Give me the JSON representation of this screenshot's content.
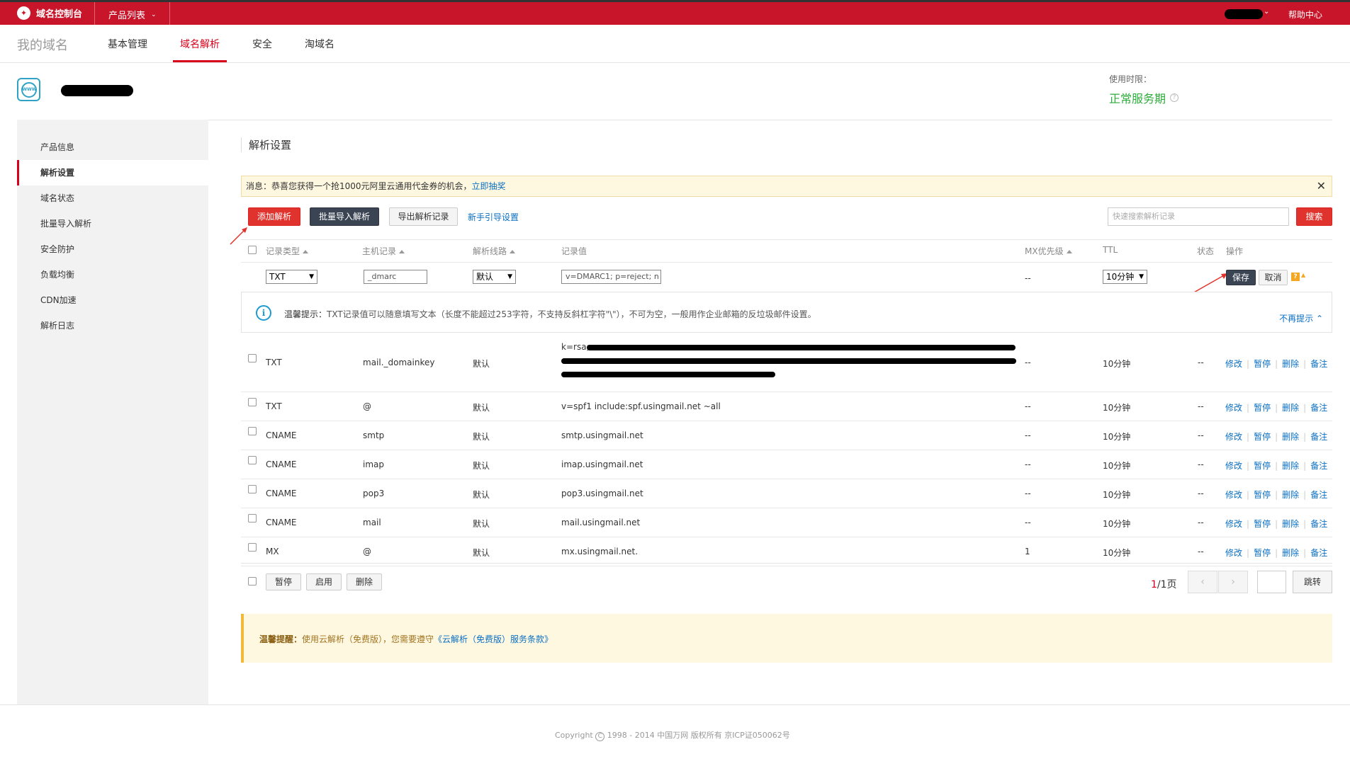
{
  "topbar": {
    "brand": "域名控制台",
    "product_list": "产品列表",
    "help": "帮助中心"
  },
  "nav": {
    "my_domains": "我的域名",
    "items": [
      "基本管理",
      "域名解析",
      "安全",
      "淘域名"
    ],
    "active": "域名解析"
  },
  "domain": {
    "icon_text": "WWW",
    "period_label": "使用时限：",
    "period_value": "正常服务期"
  },
  "sidebar": {
    "items": [
      "产品信息",
      "解析设置",
      "域名状态",
      "批量导入解析",
      "安全防护",
      "负载均衡",
      "CDN加速",
      "解析日志"
    ],
    "active": "解析设置"
  },
  "main": {
    "title": "解析设置",
    "notice_text": "消息：恭喜您获得一个抢1000元阿里云通用代金券的机会，",
    "notice_link": "立即抽奖",
    "buttons": {
      "add": "添加解析",
      "batch_import": "批量导入解析",
      "export": "导出解析记录",
      "guide": "新手引导设置",
      "search": "搜索"
    },
    "search_placeholder": "快速搜索解析记录"
  },
  "table": {
    "headers": {
      "type": "记录类型",
      "host": "主机记录",
      "line": "解析线路",
      "value": "记录值",
      "mx": "MX优先级",
      "ttl": "TTL",
      "status": "状态",
      "ops": "操作"
    },
    "edit_row": {
      "type": "TXT",
      "host": "_dmarc",
      "line": "默认",
      "value": "v=DMARC1; p=reject; n",
      "mx": "--",
      "ttl": "10分钟",
      "save": "保存",
      "cancel": "取消"
    },
    "tip": {
      "label": "温馨提示：",
      "text": "TXT记录值可以随意填写文本（长度不能超过253字符，不支持反斜杠字符\"\\\"），不可为空，一般用作企业邮箱的反垃圾邮件设置。",
      "dismiss": "不再提示"
    },
    "rows": [
      {
        "type": "TXT",
        "host": "mail._domainkey",
        "line": "默认",
        "value": "k=rsa;",
        "mx": "--",
        "ttl": "10分钟",
        "status": "--"
      },
      {
        "type": "TXT",
        "host": "@",
        "line": "默认",
        "value": "v=spf1 include:spf.usingmail.net ~all",
        "mx": "--",
        "ttl": "10分钟",
        "status": "--"
      },
      {
        "type": "CNAME",
        "host": "smtp",
        "line": "默认",
        "value": "smtp.usingmail.net",
        "mx": "--",
        "ttl": "10分钟",
        "status": "--"
      },
      {
        "type": "CNAME",
        "host": "imap",
        "line": "默认",
        "value": "imap.usingmail.net",
        "mx": "--",
        "ttl": "10分钟",
        "status": "--"
      },
      {
        "type": "CNAME",
        "host": "pop3",
        "line": "默认",
        "value": "pop3.usingmail.net",
        "mx": "--",
        "ttl": "10分钟",
        "status": "--"
      },
      {
        "type": "CNAME",
        "host": "mail",
        "line": "默认",
        "value": "mail.usingmail.net",
        "mx": "--",
        "ttl": "10分钟",
        "status": "--"
      },
      {
        "type": "MX",
        "host": "@",
        "line": "默认",
        "value": "mx.usingmail.net.",
        "mx": "1",
        "ttl": "10分钟",
        "status": "--"
      }
    ],
    "row_ops": [
      "修改",
      "暂停",
      "删除",
      "备注"
    ],
    "bulk": [
      "暂停",
      "启用",
      "删除"
    ],
    "pager": {
      "current": "1",
      "total": "/1页",
      "go": "跳转"
    }
  },
  "warm_tip": {
    "label": "温馨提醒：",
    "text": "使用云解析（免费版），您需要遵守",
    "link": "《云解析（免费版）服务条款》"
  },
  "footer": {
    "copyright": "Copyright",
    "text": "1998 - 2014 中国万网 版权所有 京ICP证050062号"
  },
  "colors": {
    "brand_red": "#c9152a",
    "active_red": "#d9001b",
    "link_blue": "#0a6fc2",
    "status_green": "#2cab3a"
  }
}
